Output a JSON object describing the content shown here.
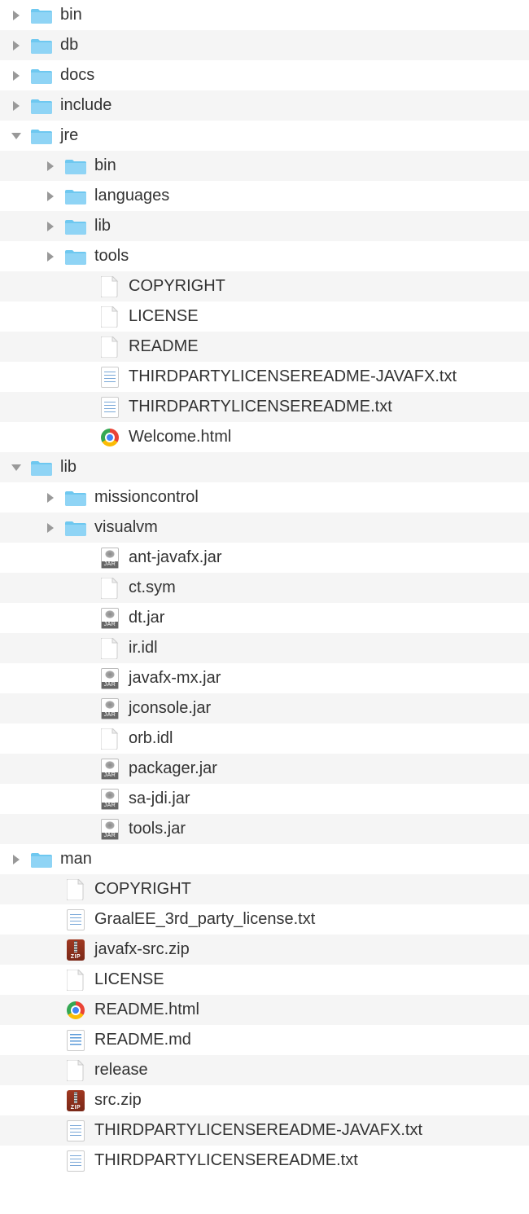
{
  "tree": [
    {
      "depth": 0,
      "disclosure": "closed",
      "icon": "folder",
      "label": "bin"
    },
    {
      "depth": 0,
      "disclosure": "closed",
      "icon": "folder",
      "label": "db"
    },
    {
      "depth": 0,
      "disclosure": "closed",
      "icon": "folder",
      "label": "docs"
    },
    {
      "depth": 0,
      "disclosure": "closed",
      "icon": "folder",
      "label": "include"
    },
    {
      "depth": 0,
      "disclosure": "open",
      "icon": "folder",
      "label": "jre"
    },
    {
      "depth": 1,
      "disclosure": "closed",
      "icon": "folder",
      "label": "bin"
    },
    {
      "depth": 1,
      "disclosure": "closed",
      "icon": "folder",
      "label": "languages"
    },
    {
      "depth": 1,
      "disclosure": "closed",
      "icon": "folder",
      "label": "lib"
    },
    {
      "depth": 1,
      "disclosure": "closed",
      "icon": "folder",
      "label": "tools"
    },
    {
      "depth": 2,
      "disclosure": "none",
      "icon": "file",
      "label": "COPYRIGHT"
    },
    {
      "depth": 2,
      "disclosure": "none",
      "icon": "file",
      "label": "LICENSE"
    },
    {
      "depth": 2,
      "disclosure": "none",
      "icon": "file",
      "label": "README"
    },
    {
      "depth": 2,
      "disclosure": "none",
      "icon": "txt",
      "label": "THIRDPARTYLICENSEREADME-JAVAFX.txt"
    },
    {
      "depth": 2,
      "disclosure": "none",
      "icon": "txt",
      "label": "THIRDPARTYLICENSEREADME.txt"
    },
    {
      "depth": 2,
      "disclosure": "none",
      "icon": "chrome",
      "label": "Welcome.html"
    },
    {
      "depth": 0,
      "disclosure": "open",
      "icon": "folder",
      "label": "lib"
    },
    {
      "depth": 1,
      "disclosure": "closed",
      "icon": "folder",
      "label": "missioncontrol"
    },
    {
      "depth": 1,
      "disclosure": "closed",
      "icon": "folder",
      "label": "visualvm"
    },
    {
      "depth": 2,
      "disclosure": "none",
      "icon": "jar",
      "label": "ant-javafx.jar"
    },
    {
      "depth": 2,
      "disclosure": "none",
      "icon": "file",
      "label": "ct.sym"
    },
    {
      "depth": 2,
      "disclosure": "none",
      "icon": "jar",
      "label": "dt.jar"
    },
    {
      "depth": 2,
      "disclosure": "none",
      "icon": "file",
      "label": "ir.idl"
    },
    {
      "depth": 2,
      "disclosure": "none",
      "icon": "jar",
      "label": "javafx-mx.jar"
    },
    {
      "depth": 2,
      "disclosure": "none",
      "icon": "jar",
      "label": "jconsole.jar"
    },
    {
      "depth": 2,
      "disclosure": "none",
      "icon": "file",
      "label": "orb.idl"
    },
    {
      "depth": 2,
      "disclosure": "none",
      "icon": "jar",
      "label": "packager.jar"
    },
    {
      "depth": 2,
      "disclosure": "none",
      "icon": "jar",
      "label": "sa-jdi.jar"
    },
    {
      "depth": 2,
      "disclosure": "none",
      "icon": "jar",
      "label": "tools.jar"
    },
    {
      "depth": 0,
      "disclosure": "closed",
      "icon": "folder",
      "label": "man"
    },
    {
      "depth": 1,
      "disclosure": "none",
      "icon": "file",
      "label": "COPYRIGHT"
    },
    {
      "depth": 1,
      "disclosure": "none",
      "icon": "txt",
      "label": "GraalEE_3rd_party_license.txt"
    },
    {
      "depth": 1,
      "disclosure": "none",
      "icon": "zip",
      "label": "javafx-src.zip"
    },
    {
      "depth": 1,
      "disclosure": "none",
      "icon": "file",
      "label": "LICENSE"
    },
    {
      "depth": 1,
      "disclosure": "none",
      "icon": "chrome",
      "label": "README.html"
    },
    {
      "depth": 1,
      "disclosure": "none",
      "icon": "md",
      "label": "README.md"
    },
    {
      "depth": 1,
      "disclosure": "none",
      "icon": "file",
      "label": "release"
    },
    {
      "depth": 1,
      "disclosure": "none",
      "icon": "zip",
      "label": "src.zip"
    },
    {
      "depth": 1,
      "disclosure": "none",
      "icon": "txt",
      "label": "THIRDPARTYLICENSEREADME-JAVAFX.txt"
    },
    {
      "depth": 1,
      "disclosure": "none",
      "icon": "txt",
      "label": "THIRDPARTYLICENSEREADME.txt"
    }
  ]
}
